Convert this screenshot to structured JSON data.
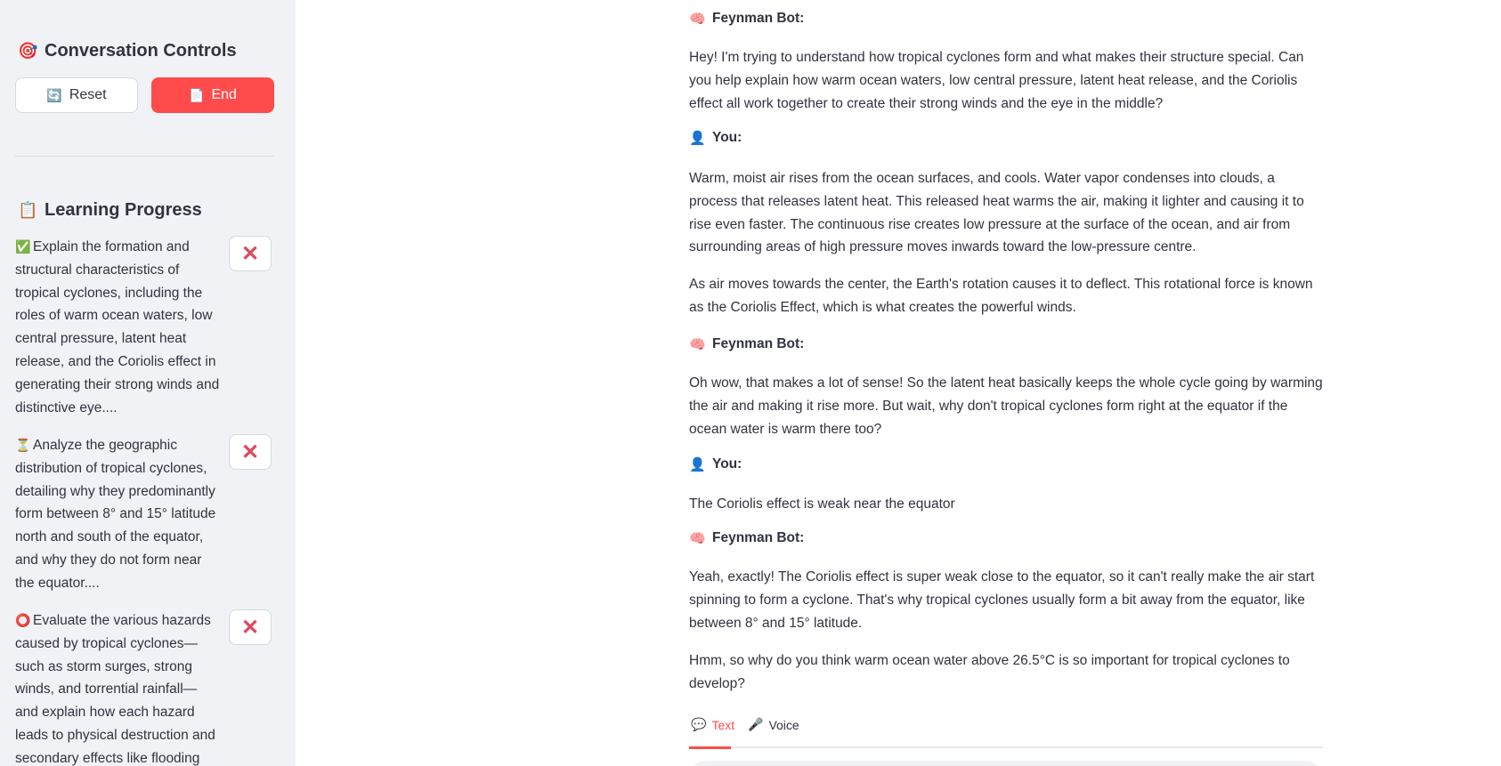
{
  "sidebar": {
    "controls_heading": "Conversation Controls",
    "controls_icon": "🎯",
    "reset_label": "Reset",
    "reset_icon": "🔄",
    "end_label": "End",
    "end_icon": "📄",
    "progress_heading": "Learning Progress",
    "progress_icon": "📋",
    "objectives": [
      {
        "status_icon": "✅",
        "text": "Explain the formation and structural characteristics of tropical cyclones, including the roles of warm ocean waters, low central pressure, latent heat release, and the Coriolis effect in generating their strong winds and distinctive eye....",
        "remove_icon": "✕"
      },
      {
        "status_icon": "⏳",
        "text": "Analyze the geographic distribution of tropical cyclones, detailing why they predominantly form between 8° and 15° latitude north and south of the equator, and why they do not form near the equator....",
        "remove_icon": "✕"
      },
      {
        "status_icon": "⭕",
        "text": "Evaluate the various hazards caused by tropical cyclones—such as storm surges, strong winds, and torrential rainfall—and explain how each hazard leads to physical destruction and secondary effects like flooding",
        "remove_icon": "✕"
      }
    ]
  },
  "chat": {
    "bot_label": "Feynman Bot:",
    "bot_icon": "🧠",
    "user_label": "You:",
    "user_icon": "👤",
    "messages": [
      {
        "role": "bot",
        "paragraphs": [
          "Hey! I'm trying to understand how tropical cyclones form and what makes their structure special. Can you help explain how warm ocean waters, low central pressure, latent heat release, and the Coriolis effect all work together to create their strong winds and the eye in the middle?"
        ]
      },
      {
        "role": "user",
        "paragraphs": [
          "Warm, moist air rises from the ocean surfaces, and cools. Water vapor condenses into clouds, a process that releases latent heat. This released heat warms the air, making it lighter and causing it to rise even faster. The continuous rise creates low pressure at the surface of the ocean, and air from surrounding areas of high pressure moves inwards toward the low-pressure centre.",
          "As air moves towards the center, the Earth's rotation causes it to deflect. This rotational force is known as the Coriolis Effect, which is what creates the powerful winds."
        ]
      },
      {
        "role": "bot",
        "paragraphs": [
          "Oh wow, that makes a lot of sense! So the latent heat basically keeps the whole cycle going by warming the air and making it rise more. But wait, why don't tropical cyclones form right at the equator if the ocean water is warm there too?"
        ]
      },
      {
        "role": "user",
        "paragraphs": [
          "The Coriolis effect is weak near the equator"
        ]
      },
      {
        "role": "bot",
        "paragraphs": [
          "Yeah, exactly! The Coriolis effect is super weak close to the equator, so it can't really make the air start spinning to form a cyclone. That's why tropical cyclones usually form a bit away from the equator, like between 8° and 15° latitude.",
          "Hmm, so why do you think warm ocean water above 26.5°C is so important for tropical cyclones to develop?"
        ]
      }
    ],
    "tabs": [
      {
        "label": "Text",
        "icon": "💬",
        "active": true
      },
      {
        "label": "Voice",
        "icon": "🎤",
        "active": false
      }
    ]
  }
}
